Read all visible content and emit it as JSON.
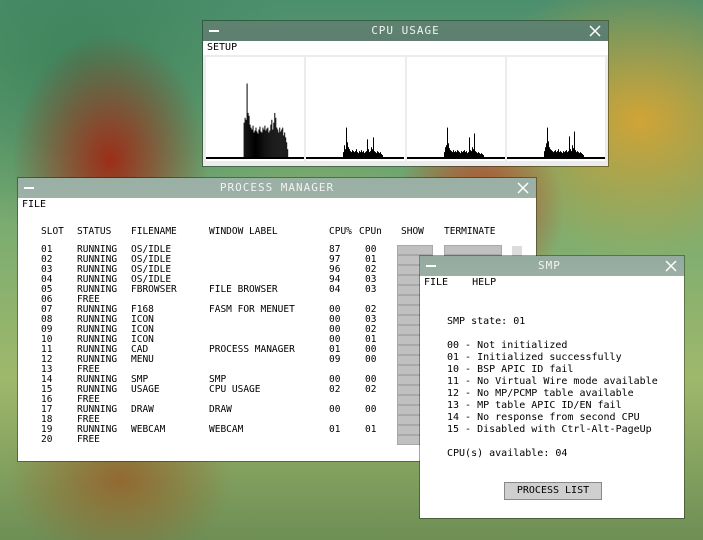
{
  "cpu_window": {
    "title": "CPU USAGE",
    "menu": [
      "SETUP"
    ],
    "graphs": [
      [
        0,
        0,
        0,
        0,
        0,
        0,
        0,
        0,
        0,
        0,
        0,
        0,
        0,
        0,
        0,
        0,
        0,
        0,
        0,
        0,
        0,
        0,
        0,
        0,
        0,
        0,
        0,
        0,
        0,
        0,
        0,
        0,
        0,
        0,
        0,
        0,
        0,
        0,
        0.35,
        0.4,
        0.38,
        0.75,
        0.45,
        0.42,
        0.33,
        0.3,
        0.28,
        0.32,
        0.25,
        0.27,
        0.3,
        0.26,
        0.24,
        0.28,
        0.31,
        0.26,
        0.25,
        0.3,
        0.28,
        0.32,
        0.27,
        0.29,
        0.3,
        0.25,
        0.27,
        0.33,
        0.38,
        0.28,
        0.35,
        0.45,
        0.4,
        0.3,
        0.28,
        0.25,
        0.3,
        0.26,
        0.28,
        0.3,
        0.22,
        0.25,
        0.2,
        0.15,
        0.08,
        0,
        0,
        0,
        0,
        0,
        0,
        0,
        0,
        0,
        0,
        0,
        0,
        0,
        0,
        0,
        0
      ],
      [
        0,
        0,
        0,
        0,
        0,
        0,
        0,
        0,
        0,
        0,
        0,
        0,
        0,
        0,
        0,
        0,
        0,
        0,
        0,
        0,
        0,
        0,
        0,
        0,
        0,
        0,
        0,
        0,
        0,
        0,
        0,
        0,
        0,
        0,
        0,
        0,
        0,
        0.05,
        0.12,
        0.08,
        0.3,
        0.15,
        0.1,
        0.08,
        0.06,
        0.05,
        0.07,
        0.06,
        0.05,
        0.06,
        0.08,
        0.05,
        0.04,
        0.06,
        0.05,
        0.07,
        0.05,
        0.06,
        0.04,
        0.05,
        0.06,
        0.18,
        0.08,
        0.05,
        0.06,
        0.1,
        0.08,
        0.2,
        0.06,
        0.05,
        0.04,
        0.06,
        0.05,
        0.04,
        0.05,
        0.03,
        0.02,
        0,
        0,
        0,
        0,
        0,
        0,
        0,
        0,
        0,
        0,
        0,
        0,
        0,
        0,
        0,
        0,
        0,
        0,
        0,
        0,
        0
      ],
      [
        0,
        0,
        0,
        0,
        0,
        0,
        0,
        0,
        0,
        0,
        0,
        0,
        0,
        0,
        0,
        0,
        0,
        0,
        0,
        0,
        0,
        0,
        0,
        0,
        0,
        0,
        0,
        0,
        0,
        0,
        0,
        0,
        0,
        0,
        0,
        0,
        0,
        0.05,
        0.1,
        0.12,
        0.3,
        0.14,
        0.09,
        0.07,
        0.06,
        0.05,
        0.07,
        0.05,
        0.06,
        0.05,
        0.07,
        0.06,
        0.05,
        0.04,
        0.06,
        0.05,
        0.06,
        0.07,
        0.05,
        0.06,
        0.04,
        0.05,
        0.2,
        0.07,
        0.06,
        0.1,
        0.08,
        0.24,
        0.06,
        0.05,
        0.04,
        0.05,
        0.04,
        0.03,
        0.04,
        0.03,
        0.02,
        0,
        0,
        0,
        0,
        0,
        0,
        0,
        0,
        0,
        0,
        0,
        0,
        0,
        0,
        0,
        0,
        0,
        0,
        0,
        0,
        0
      ],
      [
        0,
        0,
        0,
        0,
        0,
        0,
        0,
        0,
        0,
        0,
        0,
        0,
        0,
        0,
        0,
        0,
        0,
        0,
        0,
        0,
        0,
        0,
        0,
        0,
        0,
        0,
        0,
        0,
        0,
        0,
        0,
        0,
        0,
        0,
        0,
        0,
        0,
        0.06,
        0.1,
        0.14,
        0.3,
        0.16,
        0.1,
        0.08,
        0.07,
        0.06,
        0.05,
        0.06,
        0.07,
        0.05,
        0.06,
        0.08,
        0.05,
        0.06,
        0.05,
        0.04,
        0.06,
        0.05,
        0.06,
        0.07,
        0.05,
        0.06,
        0.21,
        0.08,
        0.06,
        0.12,
        0.09,
        0.26,
        0.07,
        0.05,
        0.06,
        0.05,
        0.04,
        0.05,
        0.04,
        0.03,
        0.02,
        0,
        0,
        0,
        0,
        0,
        0,
        0,
        0,
        0,
        0,
        0,
        0,
        0,
        0,
        0,
        0,
        0,
        0,
        0,
        0,
        0
      ]
    ]
  },
  "process_manager": {
    "title": "PROCESS MANAGER",
    "menu": [
      "FILE"
    ],
    "headers": {
      "slot": "SLOT",
      "status": "STATUS",
      "filename": "FILENAME",
      "window_label": "WINDOW LABEL",
      "cpu_pct": "CPU%",
      "cpun": "CPUn",
      "show": "SHOW",
      "terminate": "TERMINATE"
    },
    "rows": [
      {
        "slot": "01",
        "status": "RUNNING",
        "filename": "OS/IDLE",
        "label": "",
        "cpu": "87",
        "cpun": "00"
      },
      {
        "slot": "02",
        "status": "RUNNING",
        "filename": "OS/IDLE",
        "label": "",
        "cpu": "97",
        "cpun": "01"
      },
      {
        "slot": "03",
        "status": "RUNNING",
        "filename": "OS/IDLE",
        "label": "",
        "cpu": "96",
        "cpun": "02"
      },
      {
        "slot": "04",
        "status": "RUNNING",
        "filename": "OS/IDLE",
        "label": "",
        "cpu": "94",
        "cpun": "03"
      },
      {
        "slot": "05",
        "status": "RUNNING",
        "filename": "FBROWSER",
        "label": "FILE BROWSER",
        "cpu": "04",
        "cpun": "03"
      },
      {
        "slot": "06",
        "status": "FREE",
        "filename": "",
        "label": "",
        "cpu": "",
        "cpun": ""
      },
      {
        "slot": "07",
        "status": "RUNNING",
        "filename": "F168",
        "label": "FASM FOR MENUET",
        "cpu": "00",
        "cpun": "02"
      },
      {
        "slot": "08",
        "status": "RUNNING",
        "filename": "ICON",
        "label": "",
        "cpu": "00",
        "cpun": "03"
      },
      {
        "slot": "09",
        "status": "RUNNING",
        "filename": "ICON",
        "label": "",
        "cpu": "00",
        "cpun": "02"
      },
      {
        "slot": "10",
        "status": "RUNNING",
        "filename": "ICON",
        "label": "",
        "cpu": "00",
        "cpun": "01"
      },
      {
        "slot": "11",
        "status": "RUNNING",
        "filename": "CAD",
        "label": "PROCESS MANAGER",
        "cpu": "01",
        "cpun": "00"
      },
      {
        "slot": "12",
        "status": "RUNNING",
        "filename": "MENU",
        "label": "",
        "cpu": "09",
        "cpun": "00"
      },
      {
        "slot": "13",
        "status": "FREE",
        "filename": "",
        "label": "",
        "cpu": "",
        "cpun": ""
      },
      {
        "slot": "14",
        "status": "RUNNING",
        "filename": "SMP",
        "label": "SMP",
        "cpu": "00",
        "cpun": "00"
      },
      {
        "slot": "15",
        "status": "RUNNING",
        "filename": "USAGE",
        "label": "CPU USAGE",
        "cpu": "02",
        "cpun": "02"
      },
      {
        "slot": "16",
        "status": "FREE",
        "filename": "",
        "label": "",
        "cpu": "",
        "cpun": ""
      },
      {
        "slot": "17",
        "status": "RUNNING",
        "filename": "DRAW",
        "label": "DRAW",
        "cpu": "00",
        "cpun": "00"
      },
      {
        "slot": "18",
        "status": "FREE",
        "filename": "",
        "label": "",
        "cpu": "",
        "cpun": ""
      },
      {
        "slot": "19",
        "status": "RUNNING",
        "filename": "WEBCAM",
        "label": "WEBCAM",
        "cpu": "01",
        "cpun": "01"
      },
      {
        "slot": "20",
        "status": "FREE",
        "filename": "",
        "label": "",
        "cpu": "",
        "cpun": ""
      }
    ]
  },
  "smp_window": {
    "title": "SMP",
    "menu": [
      "FILE",
      "HELP"
    ],
    "state": "SMP state: 01",
    "codes": [
      "00 - Not initialized",
      "01 - Initialized successfully",
      "10 - BSP APIC ID fail",
      "11 - No Virtual Wire mode available",
      "12 - No MP/PCMP table available",
      "13 - MP table APIC ID/EN fail",
      "14 - No response from second CPU",
      "15 - Disabled with Ctrl-Alt-PageUp"
    ],
    "cpus": "CPU(s) available: 04",
    "button_label": "PROCESS LIST"
  }
}
